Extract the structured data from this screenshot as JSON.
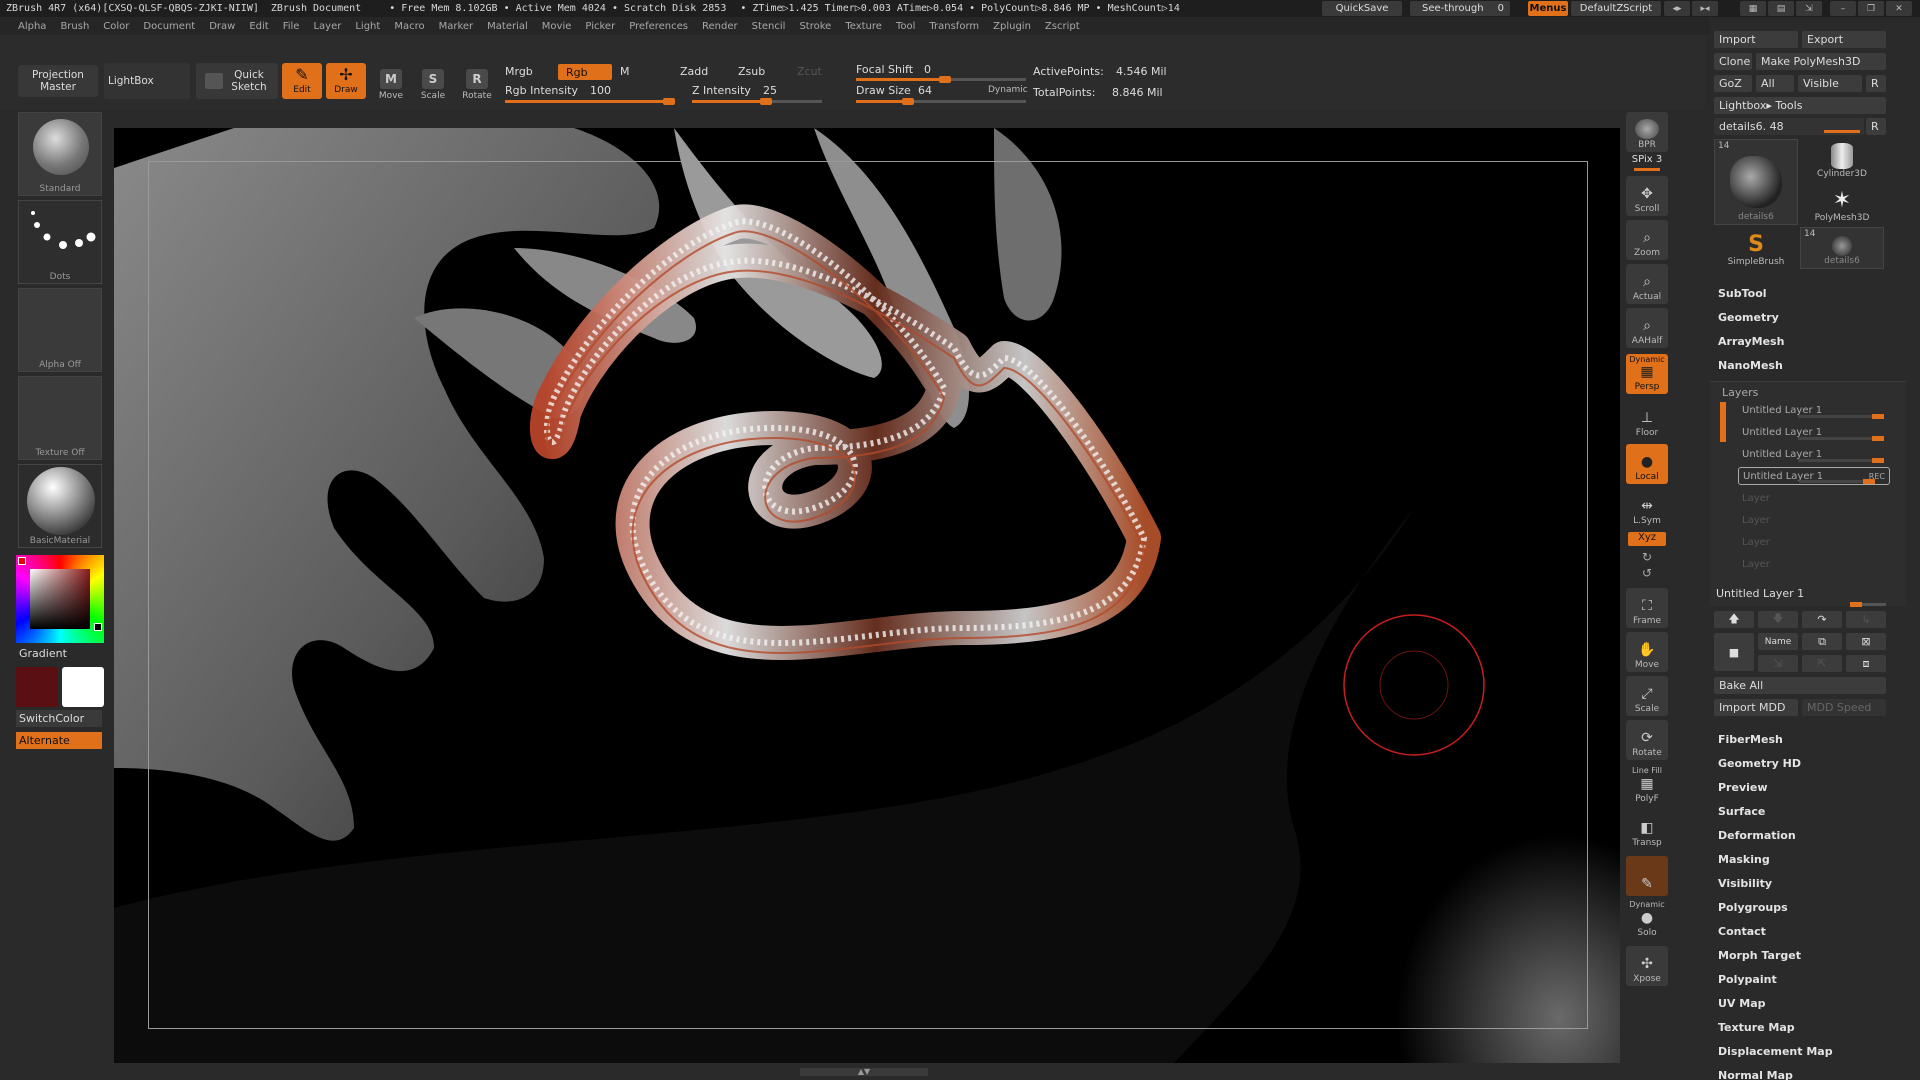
{
  "titlebar": {
    "app": "ZBrush 4R7 (x64)[CXSQ-QLSF-QBQS-ZJKI-NIIW]",
    "document": "ZBrush Document",
    "mem_stats": "• Free Mem 8.102GB • Active Mem 4024 • Scratch Disk 2853",
    "time_stats": "• ZTime▷1.425 Timer▷0.003 ATime▷0.054 • PolyCount▷8.846 MP • MeshCount▷14",
    "quicksave": "QuickSave",
    "see_through": "See-through",
    "see_through_value": "0",
    "menus": "Menus",
    "default_zscript": "DefaultZScript"
  },
  "menubar": [
    "Alpha",
    "Brush",
    "Color",
    "Document",
    "Draw",
    "Edit",
    "File",
    "Layer",
    "Light",
    "Macro",
    "Marker",
    "Material",
    "Movie",
    "Picker",
    "Preferences",
    "Render",
    "Stencil",
    "Stroke",
    "Texture",
    "Tool",
    "Transform",
    "Zplugin",
    "Zscript"
  ],
  "toolbar": {
    "projection_master": "Projection Master",
    "lightbox": "LightBox",
    "quick_sketch": "Quick Sketch",
    "edit": "Edit",
    "draw": "Draw",
    "move": "Move",
    "scale": "Scale",
    "rotate": "Rotate",
    "mrgb": "Mrgb",
    "rgb": "Rgb",
    "m": "M",
    "rgb_intensity_label": "Rgb Intensity",
    "rgb_intensity": "100",
    "zadd": "Zadd",
    "zsub": "Zsub",
    "zcut": "Zcut",
    "z_intensity_label": "Z Intensity",
    "z_intensity": "25",
    "focal_shift_label": "Focal Shift",
    "focal_shift": "0",
    "draw_size_label": "Draw Size",
    "draw_size": "64",
    "dynamic": "Dynamic",
    "active_points_label": "ActivePoints:",
    "active_points": "4.546 Mil",
    "total_points_label": "TotalPoints:",
    "total_points": "8.846 Mil"
  },
  "leftshelf": {
    "brush": "Standard",
    "stroke": "Dots",
    "alpha": "Alpha Off",
    "texture": "Texture Off",
    "material": "BasicMaterial",
    "gradient": "Gradient",
    "switch_color": "SwitchColor",
    "alternate": "Alternate",
    "primary_color": "#5a0f12",
    "secondary_color": "#ffffff"
  },
  "rightshelf": {
    "bpr": "BPR",
    "spix_label": "SPix",
    "spix": "3",
    "scroll": "Scroll",
    "zoom": "Zoom",
    "actual": "Actual",
    "aahalf": "AAHalf",
    "dynamic": "Dynamic",
    "persp": "Persp",
    "floor": "Floor",
    "local": "Local",
    "lsym": "L.Sym",
    "xyz": "Xyz",
    "frame": "Frame",
    "move": "Move",
    "scale": "Scale",
    "rotate": "Rotate",
    "line_fill": "Line Fill",
    "polyf": "PolyF",
    "transp": "Transp",
    "dynamic2": "Dynamic",
    "solo": "Solo",
    "xpose": "Xpose"
  },
  "panel": {
    "import": "Import",
    "export": "Export",
    "clone": "Clone",
    "make_polymesh": "Make PolyMesh3D",
    "goz": "GoZ",
    "all": "All",
    "visible": "Visible",
    "r": "R",
    "lightbox_tools": "Lightbox▸ Tools",
    "tool_name": "details6. 48",
    "tools": [
      {
        "name": "details6",
        "count": "14"
      },
      {
        "name": "Cylinder3D",
        "count": ""
      },
      {
        "name": "PolyMesh3D",
        "count": ""
      },
      {
        "name": "SimpleBrush",
        "count": ""
      },
      {
        "name": "details6",
        "count": "14"
      }
    ],
    "sections_top": [
      "SubTool",
      "Geometry",
      "ArrayMesh",
      "NanoMesh"
    ],
    "layers_title": "Layers",
    "layers": [
      "Untitled Layer 1",
      "Untitled Layer 1",
      "Untitled Layer 1",
      "Untitled Layer 1"
    ],
    "rec": "REC",
    "empty_layers": [
      "Layer",
      "Layer",
      "Layer",
      "Layer"
    ],
    "current_layer": "Untitled Layer 1",
    "name_btn": "Name",
    "bake_all": "Bake All",
    "import_mdd": "Import MDD",
    "mdd_speed": "MDD Speed",
    "sections_bottom": [
      "FiberMesh",
      "Geometry HD",
      "Preview",
      "Surface",
      "Deformation",
      "Masking",
      "Visibility",
      "Polygroups",
      "Contact",
      "Morph Target",
      "Polypaint",
      "UV Map",
      "Texture Map",
      "Displacement Map",
      "Normal Map"
    ]
  }
}
